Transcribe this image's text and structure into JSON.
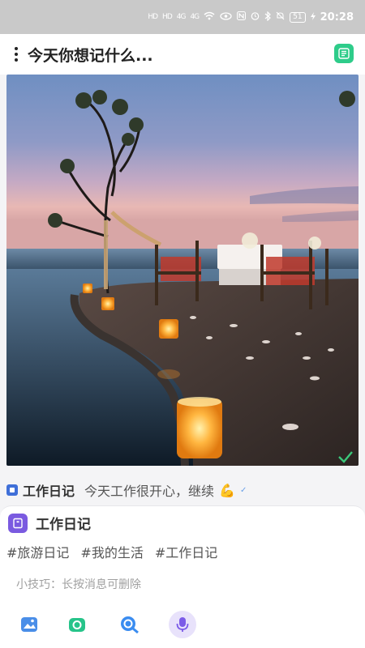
{
  "status_bar": {
    "network_1": "HD",
    "network_2": "HD",
    "signal_1": "4G",
    "signal_2": "4G",
    "battery": "51",
    "time": "20:28"
  },
  "header": {
    "prompt_title": "今天你想记什么..."
  },
  "entry_preview": {
    "title": "工作日记",
    "text": "今天工作很开心，继续",
    "emoji": "💪"
  },
  "composer": {
    "category": "工作日记",
    "tags": [
      "#旅游日记",
      "#我的生活",
      "#工作日记"
    ],
    "tip": "小技巧：长按消息可删除"
  },
  "toolbar": {
    "icons": [
      "image-icon",
      "camera-icon",
      "search-icon",
      "voice-icon"
    ]
  },
  "colors": {
    "accent_green": "#2ecc8a",
    "accent_purple": "#7a5ae0",
    "accent_blue": "#3f6fd8"
  }
}
